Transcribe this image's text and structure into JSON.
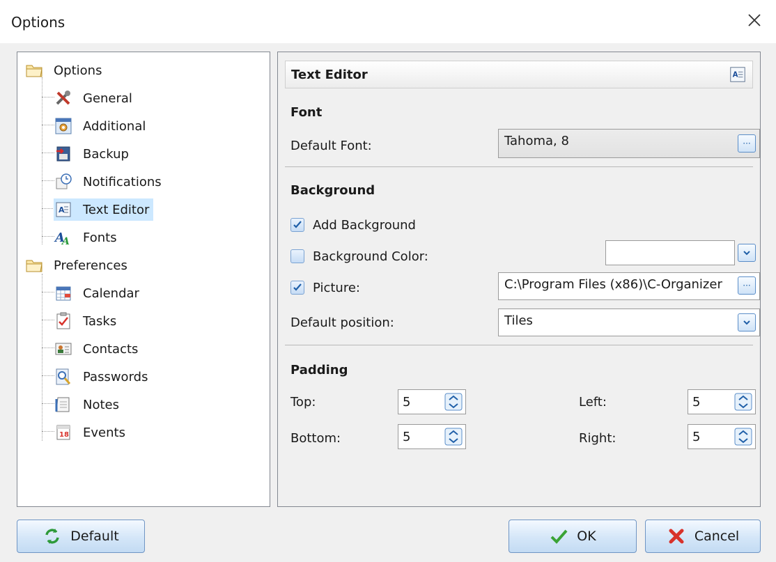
{
  "window": {
    "title": "Options"
  },
  "tree": {
    "root1": "Options",
    "items1": [
      {
        "label": "General",
        "icon": "tools-icon"
      },
      {
        "label": "Additional",
        "icon": "window-gear-icon"
      },
      {
        "label": "Backup",
        "icon": "backup-disk-icon"
      },
      {
        "label": "Notifications",
        "icon": "notification-clock-icon"
      },
      {
        "label": "Text Editor",
        "icon": "text-editor-icon"
      },
      {
        "label": "Fonts",
        "icon": "fonts-icon"
      }
    ],
    "root2": "Preferences",
    "items2": [
      {
        "label": "Calendar",
        "icon": "calendar-icon"
      },
      {
        "label": "Tasks",
        "icon": "tasks-icon"
      },
      {
        "label": "Contacts",
        "icon": "contacts-icon"
      },
      {
        "label": "Passwords",
        "icon": "passwords-icon"
      },
      {
        "label": "Notes",
        "icon": "notes-icon"
      },
      {
        "label": "Events",
        "icon": "events-icon"
      }
    ],
    "selected": "Text Editor"
  },
  "panel": {
    "title": "Text Editor",
    "font_section": "Font",
    "default_font_label": "Default Font:",
    "default_font_value": "Tahoma, 8",
    "background_section": "Background",
    "add_background_label": "Add Background",
    "add_background_checked": true,
    "background_color_label": "Background Color:",
    "background_color_checked": false,
    "picture_label": "Picture:",
    "picture_checked": true,
    "picture_value": "C:\\Program Files (x86)\\C-Organizer",
    "default_position_label": "Default position:",
    "default_position_value": "Tiles",
    "padding_section": "Padding",
    "top_label": "Top:",
    "top_value": "5",
    "bottom_label": "Bottom:",
    "bottom_value": "5",
    "left_label": "Left:",
    "left_value": "5",
    "right_label": "Right:",
    "right_value": "5"
  },
  "buttons": {
    "default": "Default",
    "ok": "OK",
    "cancel": "Cancel"
  },
  "colors": {
    "selection": "#cce8ff",
    "button_border": "#6f95c4",
    "check_blue": "#1f5fa8"
  }
}
